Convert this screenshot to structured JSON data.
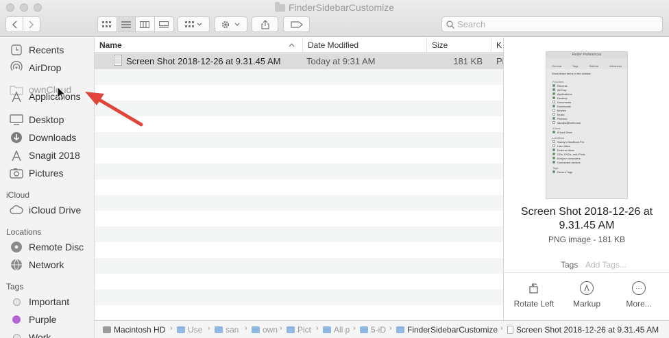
{
  "window": {
    "title": "FinderSidebarCustomize"
  },
  "toolbar": {
    "search_placeholder": "Search"
  },
  "sidebar": {
    "items": [
      {
        "label": "Recents",
        "icon": "clock-icon"
      },
      {
        "label": "AirDrop",
        "icon": "airdrop-icon"
      },
      {
        "label": "ownCloud",
        "icon": "folder-icon"
      },
      {
        "label": "Applications",
        "icon": "apps-icon"
      },
      {
        "label": "Desktop",
        "icon": "desktop-icon"
      },
      {
        "label": "Downloads",
        "icon": "download-icon"
      },
      {
        "label": "Snagit 2018",
        "icon": "apps-icon"
      },
      {
        "label": "Pictures",
        "icon": "camera-icon"
      }
    ],
    "icloud_header": "iCloud",
    "icloud_items": [
      {
        "label": "iCloud Drive",
        "icon": "cloud-icon"
      }
    ],
    "locations_header": "Locations",
    "locations_items": [
      {
        "label": "Remote Disc",
        "icon": "disc-icon"
      },
      {
        "label": "Network",
        "icon": "globe-icon"
      }
    ],
    "tags_header": "Tags",
    "tags_items": [
      {
        "label": "Important",
        "color": "#e5e5e5"
      },
      {
        "label": "Purple",
        "color": "#b365d4"
      },
      {
        "label": "Work",
        "color": "#e5e5e5"
      }
    ]
  },
  "list": {
    "columns": {
      "name": "Name",
      "date": "Date Modified",
      "size": "Size",
      "kind": "K"
    },
    "rows": [
      {
        "name": "Screen Shot 2018-12-26 at 9.31.45 AM",
        "date": "Today at 9:31 AM",
        "size": "181 KB",
        "kind": "Pi"
      }
    ]
  },
  "preview": {
    "name": "Screen Shot 2018-12-26 at 9.31.45 AM",
    "info": "PNG image - 181 KB",
    "tags_label": "Tags",
    "tags_placeholder": "Add Tags...",
    "actions": [
      "Rotate Left",
      "Markup",
      "More..."
    ],
    "thumb": {
      "title": "Finder Preferences",
      "tabs": [
        "General",
        "Tags",
        "Sidebar",
        "Advanced"
      ],
      "heading": "Show these items in the sidebar:",
      "sections": [
        {
          "name": "Favorites",
          "items": [
            {
              "label": "Recents",
              "checked": true
            },
            {
              "label": "AirDrop",
              "checked": true
            },
            {
              "label": "Applications",
              "checked": true
            },
            {
              "label": "Desktop",
              "checked": true
            },
            {
              "label": "Documents",
              "checked": false
            },
            {
              "label": "Downloads",
              "checked": true
            },
            {
              "label": "Movies",
              "checked": false
            },
            {
              "label": "Music",
              "checked": false
            },
            {
              "label": "Pictures",
              "checked": true
            },
            {
              "label": "sandyw@hmhouse",
              "checked": false
            }
          ]
        },
        {
          "name": "iCloud",
          "items": [
            {
              "label": "iCloud Drive",
              "checked": true
            }
          ]
        },
        {
          "name": "Locations",
          "items": [
            {
              "label": "Sandy's MacBook Pro",
              "checked": false
            },
            {
              "label": "Hard disks",
              "checked": false
            },
            {
              "label": "External disks",
              "checked": true
            },
            {
              "label": "CDs, DVDs, and iPods",
              "checked": true
            },
            {
              "label": "Bonjour computers",
              "checked": true
            },
            {
              "label": "Connected servers",
              "checked": true
            }
          ]
        },
        {
          "name": "Tags",
          "items": [
            {
              "label": "Recent Tags",
              "checked": true
            }
          ]
        }
      ]
    }
  },
  "pathbar": [
    {
      "label": "Macintosh HD",
      "gray": false
    },
    {
      "label": "Use",
      "gray": true
    },
    {
      "label": "san",
      "gray": true
    },
    {
      "label": "own",
      "gray": true
    },
    {
      "label": "Pict",
      "gray": true
    },
    {
      "label": "All p",
      "gray": true
    },
    {
      "label": "5-iD",
      "gray": true
    },
    {
      "label": "FinderSidebarCustomize",
      "gray": false
    },
    {
      "label": "Screen Shot 2018-12-26 at 9.31.45 AM",
      "gray": false
    }
  ]
}
